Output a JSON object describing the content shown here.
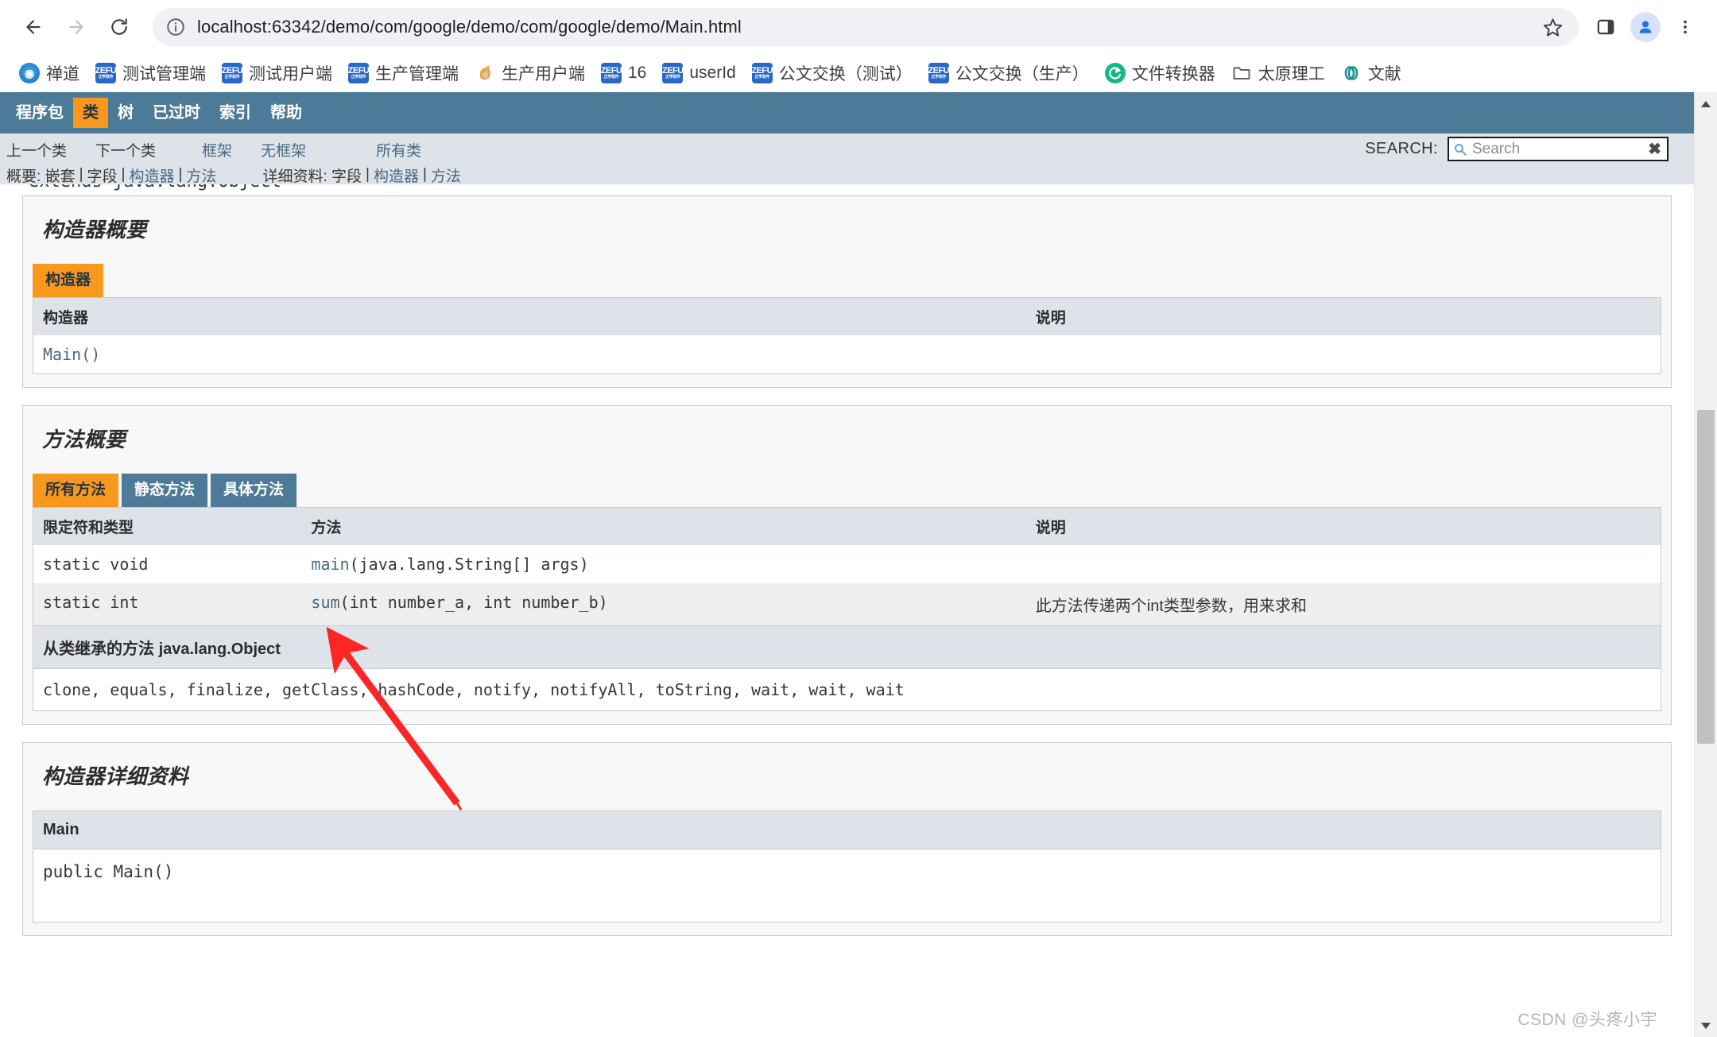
{
  "browser": {
    "back_tooltip": "Back",
    "forward_tooltip": "Forward",
    "reload_tooltip": "Reload",
    "url": "localhost:63342/demo/com/google/demo/com/google/demo/Main.html",
    "star_tooltip": "Bookmark this tab",
    "side_panel_tooltip": "Side panel",
    "profile_tooltip": "Profile",
    "menu_tooltip": "Customize and control"
  },
  "bookmarks": [
    {
      "label": "禅道",
      "icon": "zentao-icon",
      "kind": "zentao"
    },
    {
      "label": "测试管理端",
      "icon": "zefu-icon",
      "kind": "zefu"
    },
    {
      "label": "测试用户端",
      "icon": "zefu-icon",
      "kind": "zefu"
    },
    {
      "label": "生产管理端",
      "icon": "zefu-icon",
      "kind": "zefu"
    },
    {
      "label": "生产用户端",
      "icon": "flame-icon",
      "kind": "prod"
    },
    {
      "label": "16",
      "icon": "zefu-icon",
      "kind": "zefu"
    },
    {
      "label": "userId",
      "icon": "zefu-icon",
      "kind": "zefu"
    },
    {
      "label": "公文交换（测试）",
      "icon": "zefu-icon",
      "kind": "zefu"
    },
    {
      "label": "公文交换（生产）",
      "icon": "zefu-icon",
      "kind": "zefu"
    },
    {
      "label": "文件转换器",
      "icon": "recycle-icon",
      "kind": "conv"
    },
    {
      "label": "太原理工",
      "icon": "folder-icon",
      "kind": "folder"
    },
    {
      "label": "文献",
      "icon": "rings-icon",
      "kind": "lit"
    }
  ],
  "javadoc": {
    "topnav": [
      {
        "label": "程序包",
        "active": false
      },
      {
        "label": "类",
        "active": true
      },
      {
        "label": "树",
        "active": false
      },
      {
        "label": "已过时",
        "active": false
      },
      {
        "label": "索引",
        "active": false
      },
      {
        "label": "帮助",
        "active": false
      }
    ],
    "subnav": {
      "prev_class": "上一个类",
      "next_class": "下一个类",
      "frames": "框架",
      "no_frames": "无框架",
      "all_classes": "所有类",
      "summary_label": "概要:",
      "summary_items": [
        "嵌套",
        "字段",
        "构造器",
        "方法"
      ],
      "detail_label": "详细资料:",
      "detail_items": [
        "字段",
        "构造器",
        "方法"
      ],
      "separator": "|"
    },
    "search": {
      "label": "SEARCH:",
      "placeholder": "Search",
      "value": "",
      "clear_glyph": "✖"
    },
    "clipped_extends": "extends java.lang.Object",
    "constructor_summary": {
      "title": "构造器概要",
      "tab": "构造器",
      "columns": [
        "构造器",
        "说明"
      ],
      "rows": [
        {
          "constructor": "Main()",
          "description": ""
        }
      ]
    },
    "method_summary": {
      "title": "方法概要",
      "tabs": [
        {
          "label": "所有方法",
          "active": true
        },
        {
          "label": "静态方法",
          "active": false
        },
        {
          "label": "具体方法",
          "active": false
        }
      ],
      "columns": [
        "限定符和类型",
        "方法",
        "说明"
      ],
      "rows": [
        {
          "modifier": "static void",
          "method_name": "main",
          "method_args": "(java.lang.String[] args)",
          "description": ""
        },
        {
          "modifier": "static int",
          "method_name": "sum",
          "method_args": "(int number_a, int number_b)",
          "description": "此方法传递两个int类型参数，用来求和"
        }
      ],
      "inherited_title_prefix": "从类继承的方法 ",
      "inherited_class": "java.lang.Object",
      "inherited_methods": "clone, equals, finalize, getClass, hashCode, notify, notifyAll, toString, wait, wait, wait"
    },
    "constructor_detail": {
      "title": "构造器详细资料",
      "anchor": "Main",
      "signature": "public Main()"
    }
  },
  "watermark": "CSDN @头疼小宇"
}
